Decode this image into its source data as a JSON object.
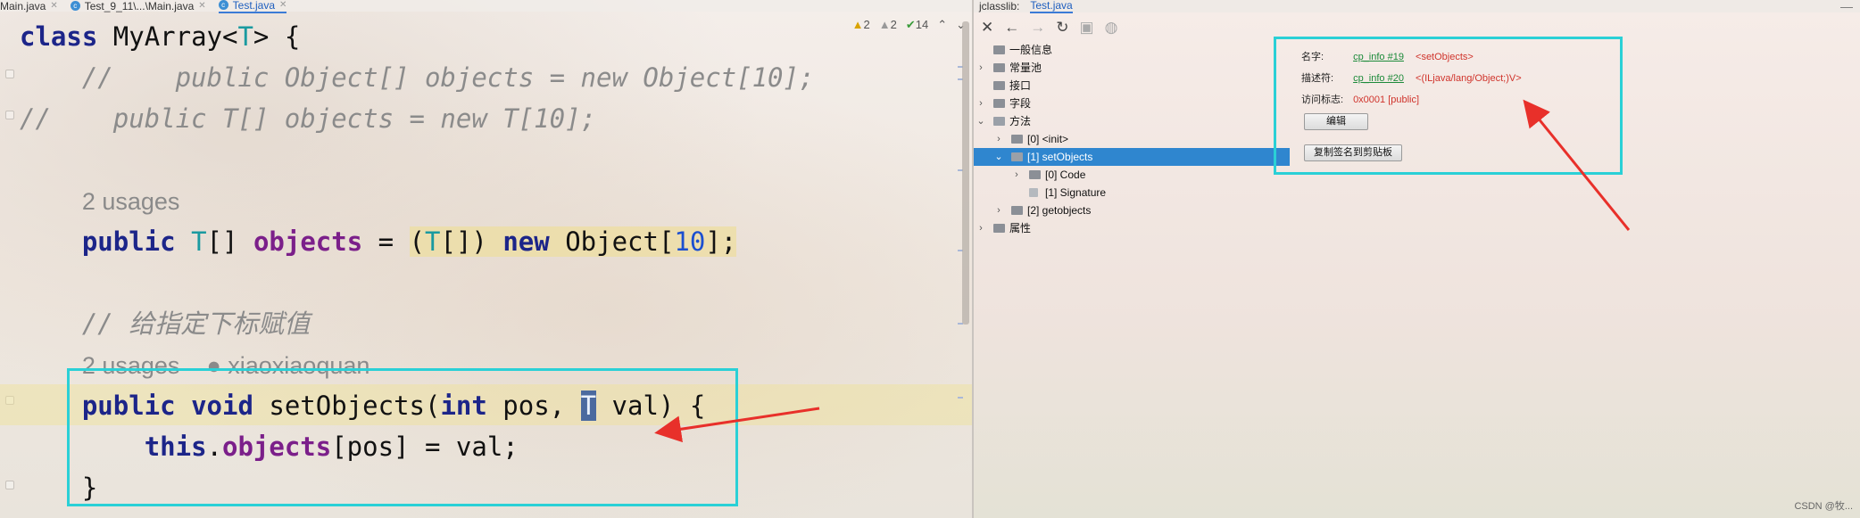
{
  "editor": {
    "tabs": [
      {
        "label": "Main.java",
        "active": false
      },
      {
        "label": "Test_9_11\\...\\Main.java",
        "active": false
      },
      {
        "label": "Test.java",
        "active": true
      }
    ],
    "inspections": {
      "warnings": "2",
      "weak_warnings": "2",
      "ok": "14"
    },
    "code": {
      "l1_kw": "class",
      "l1_name": " MyArray<",
      "l1_type": "T",
      "l1_end": "> {",
      "l2": "    //    public Object[] objects = new Object[10];",
      "l3": "//    public T[] objects = new T[10];",
      "l5_hint": "2 usages",
      "l6_kw": "public",
      "l6_type": "T",
      "l6_mid": "[] ",
      "l6_field": "objects",
      "l6_eq": " = ",
      "l6_cast_a": "(",
      "l6_cast_t": "T",
      "l6_cast_b": "[])",
      "l6_sp": " ",
      "l6_new": "new",
      "l6_obj": " Object[",
      "l6_num": "10",
      "l6_end": "];",
      "l8": "// 给指定下标赋值",
      "l9_hint": "2 usages",
      "l9_author": "xiaoxiaoquan",
      "l10_kw1": "public",
      "l10_kw2": "void",
      "l10_name": "setObjects(",
      "l10_int": "int",
      "l10_mid": " pos, ",
      "l10_t": "T",
      "l10_end": " val) {",
      "l11_this": "this",
      "l11_dot": ".",
      "l11_field": "objects",
      "l11_end": "[pos] = val;",
      "l12": "}"
    }
  },
  "jclasslib": {
    "title": "jclasslib:",
    "tab": "Test.java",
    "toolbar_icons": [
      "close-icon",
      "back-arrow-icon",
      "forward-arrow-icon",
      "refresh-icon",
      "save-icon",
      "globe-icon"
    ],
    "tree": [
      {
        "label": "一般信息",
        "depth": 0,
        "expandable": false
      },
      {
        "label": "常量池",
        "depth": 0,
        "expandable": true
      },
      {
        "label": "接口",
        "depth": 0,
        "expandable": false
      },
      {
        "label": "字段",
        "depth": 0,
        "expandable": true
      },
      {
        "label": "方法",
        "depth": 0,
        "expandable": true,
        "open": true
      },
      {
        "label": "[0] <init>",
        "depth": 1,
        "expandable": true
      },
      {
        "label": "[1] setObjects",
        "depth": 1,
        "expandable": true,
        "open": true,
        "selected": true
      },
      {
        "label": "[0] Code",
        "depth": 2,
        "expandable": true
      },
      {
        "label": "[1] Signature",
        "depth": 2,
        "expandable": false
      },
      {
        "label": "[2] getobjects",
        "depth": 1,
        "expandable": true
      },
      {
        "label": "属性",
        "depth": 0,
        "expandable": true
      }
    ],
    "detail": {
      "name_label": "名字:",
      "name_link": "cp_info #19",
      "name_value": "<setObjects>",
      "desc_label": "描述符:",
      "desc_link": "cp_info #20",
      "desc_value": "<(ILjava/lang/Object;)V>",
      "flags_label": "访问标志:",
      "flags_value": "0x0001 [public]",
      "edit_button": "编辑",
      "copy_button": "复制签名到剪贴板"
    }
  },
  "watermark": "CSDN @牧...",
  "colors": {
    "annotation_box": "#2ad0d6",
    "arrow": "#e8302a",
    "selection": "#2f86cf"
  }
}
